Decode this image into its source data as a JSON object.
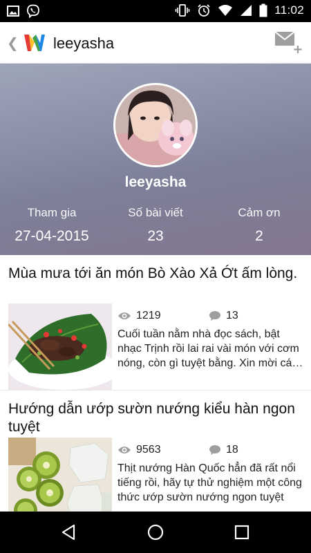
{
  "status_bar": {
    "time": "11:02",
    "left_icons": [
      "image-icon",
      "viber-icon"
    ],
    "right_icons": [
      "vibrate-icon",
      "alarm-icon",
      "wifi-icon",
      "signal-icon",
      "battery-icon"
    ]
  },
  "app_bar": {
    "title": "leeyasha",
    "back_icon": "chevron-left-icon",
    "logo": "w-logo",
    "action_icon": "mail-add-icon"
  },
  "profile": {
    "name": "leeyasha",
    "stats": [
      {
        "label": "Tham gia",
        "value": "27-04-2015"
      },
      {
        "label": "Số bài viết",
        "value": "23"
      },
      {
        "label": "Cảm ơn",
        "value": "2"
      }
    ]
  },
  "articles": [
    {
      "title": "Mùa mưa tới ăn món Bò Xào Xả Ớt ấm lòng.",
      "views": "1219",
      "comments": "13",
      "excerpt": "Cuối tuần nằm nhà đọc sách, bật nhạc Trịnh rồi lai rai vài món với cơm nóng, còn gì tuyệt bằng. Xin mời các bạn cùng vào bếp"
    },
    {
      "title": "Hướng dẫn ướp sườn nướng kiểu hàn ngon tuyệt",
      "views": "9563",
      "comments": "18",
      "excerpt": "Thịt nướng Hàn Quốc hẳn đã rất nổi tiếng rồi, hãy tự thử nghiệm một công thức ướp sườn nướng ngon tuyệt"
    }
  ],
  "nav_bar": {
    "buttons": [
      "back-triangle-icon",
      "home-circle-icon",
      "recents-square-icon"
    ]
  },
  "colors": {
    "status_bar": "#000000",
    "header_gradient_top": "#9ea6b9",
    "header_gradient_bottom": "#85768f",
    "text": "#111111"
  }
}
